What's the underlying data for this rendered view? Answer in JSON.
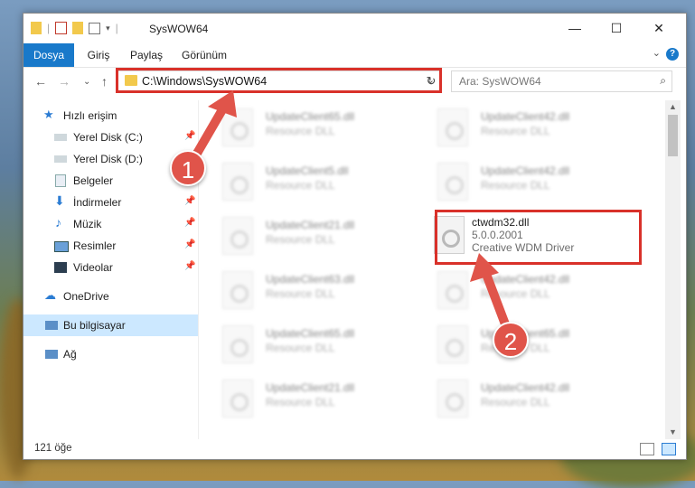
{
  "window": {
    "title": "SysWOW64"
  },
  "ribbon": {
    "tabs": [
      "Dosya",
      "Giriş",
      "Paylaş",
      "Görünüm"
    ],
    "help_label": "?"
  },
  "address": {
    "path": "C:\\Windows\\SysWOW64"
  },
  "search": {
    "placeholder": "Ara: SysWOW64"
  },
  "sidebar": {
    "items": [
      {
        "label": "Hızlı erişim",
        "icon": "star-icon"
      },
      {
        "label": "Yerel Disk (C:)",
        "icon": "drive-icon"
      },
      {
        "label": "Yerel Disk (D:)",
        "icon": "drive-icon"
      },
      {
        "label": "Belgeler",
        "icon": "documents-icon"
      },
      {
        "label": "İndirmeler",
        "icon": "download-icon"
      },
      {
        "label": "Müzik",
        "icon": "music-icon"
      },
      {
        "label": "Resimler",
        "icon": "pictures-icon"
      },
      {
        "label": "Videolar",
        "icon": "videos-icon"
      },
      {
        "label": "OneDrive",
        "icon": "cloud-icon"
      },
      {
        "label": "Bu bilgisayar",
        "icon": "computer-icon"
      },
      {
        "label": "Ağ",
        "icon": "network-icon"
      }
    ]
  },
  "files": {
    "left": [
      {
        "name": "UpdateClient65.dll",
        "desc": "Resource DLL"
      },
      {
        "name": "UpdateClient5.dll",
        "desc": "Resource DLL"
      },
      {
        "name": "UpdateClient21.dll",
        "desc": "Resource DLL"
      },
      {
        "name": "UpdateClient63.dll",
        "desc": "Resource DLL"
      },
      {
        "name": "UpdateClient65.dll",
        "desc": "Resource DLL"
      },
      {
        "name": "UpdateClient21.dll",
        "desc": "Resource DLL"
      }
    ],
    "right": [
      {
        "name": "UpdateClient42.dll",
        "desc": "Resource DLL"
      },
      {
        "name": "UpdateClient42.dll",
        "desc": "Resource DLL"
      },
      {
        "name": "UpdateClient42.dll",
        "desc": "Resource DLL"
      },
      {
        "name": "UpdateClient65.dll",
        "desc": "Resource DLL"
      },
      {
        "name": "UpdateClient42.dll",
        "desc": "Resource DLL"
      }
    ],
    "highlighted": {
      "name": "ctwdm32.dll",
      "version": "5.0.0.2001",
      "company": "Creative WDM Driver"
    }
  },
  "status": {
    "count": "121 öğe"
  },
  "annotations": {
    "badge1": "1",
    "badge2": "2",
    "color": "#d9312a"
  }
}
